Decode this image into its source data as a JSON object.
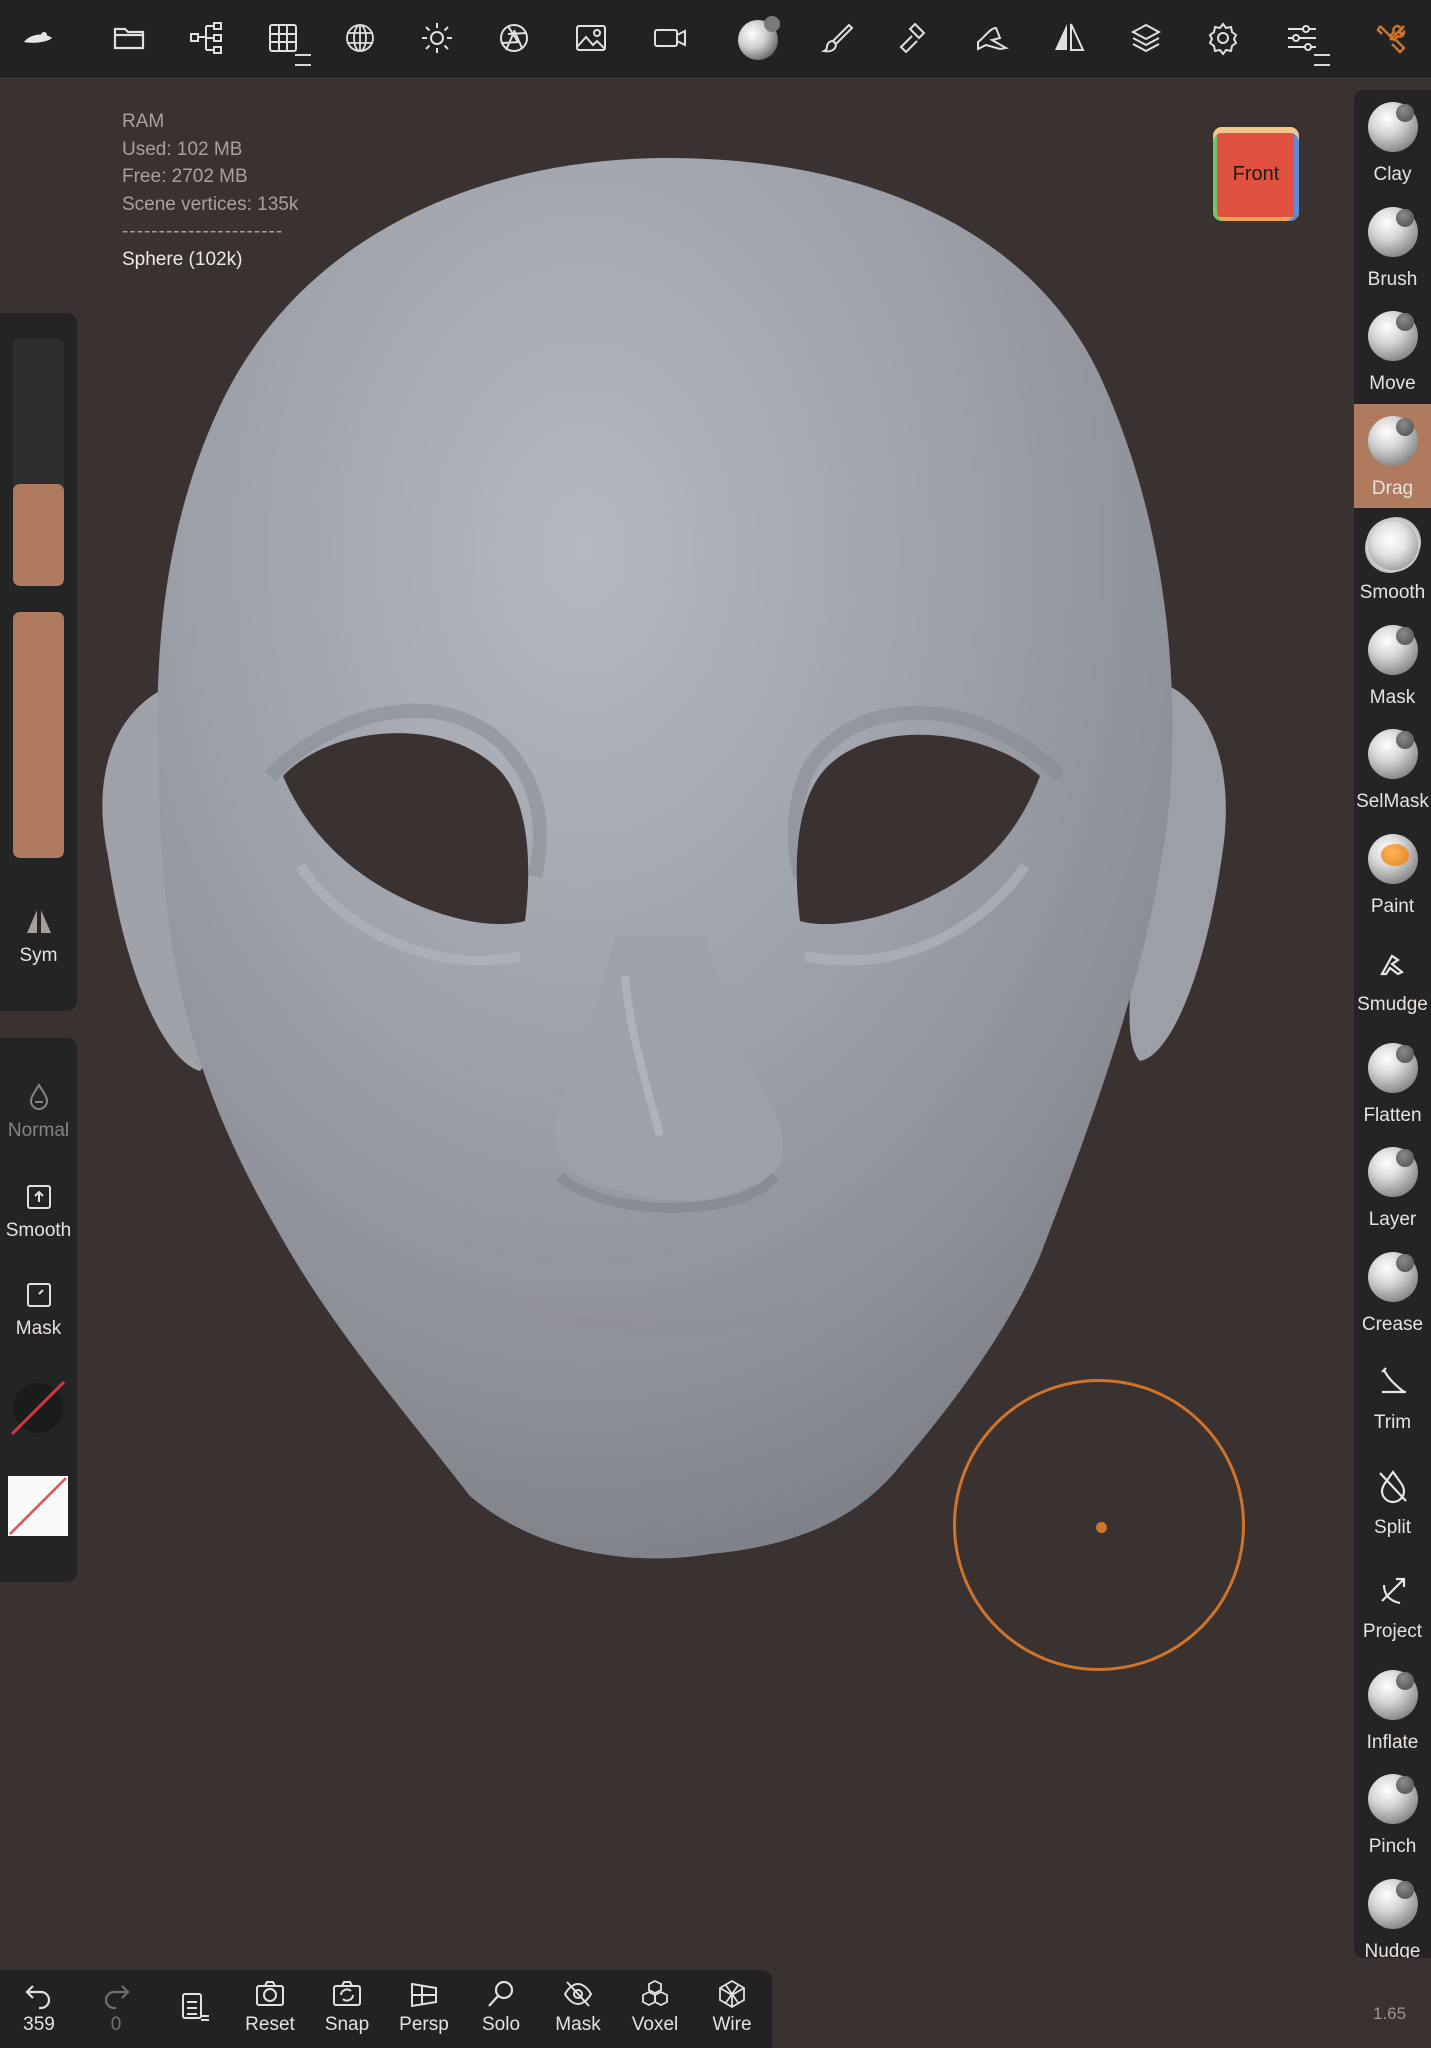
{
  "app": {
    "accent_color": "#b07a5e",
    "background_color": "#3a3230",
    "cursor_color": "#d0742c"
  },
  "topbar": {
    "icons": [
      "logo-icon",
      "folder-icon",
      "scene-tree-icon",
      "grid-icon",
      "mesh-sphere-icon",
      "light-icon",
      "aperture-icon",
      "image-icon",
      "camera-icon",
      "material-sphere-icon",
      "paint-brush-icon",
      "sculpt-hammer-icon",
      "topology-icon",
      "symmetry-icon",
      "layers-icon",
      "settings-icon",
      "sliders-icon",
      "tools-icon"
    ]
  },
  "stats": {
    "ram_label": "RAM",
    "used": "Used: 102 MB",
    "free": "Free: 2702 MB",
    "vertices": "Scene vertices: 135k",
    "separator": "----------------------",
    "object": "Sphere (102k)"
  },
  "viewcube": {
    "face": "Front"
  },
  "left_panel": {
    "radius_slider_level": 0.41,
    "intensity_slider_level": 1.0,
    "sym_label": "Sym",
    "normal_label": "Normal",
    "smooth_label": "Smooth",
    "mask_label": "Mask"
  },
  "tools": [
    {
      "label": "Clay",
      "icon": "clay-icon",
      "active": false
    },
    {
      "label": "Brush",
      "icon": "brush-icon",
      "active": false
    },
    {
      "label": "Move",
      "icon": "move-icon",
      "active": false
    },
    {
      "label": "Drag",
      "icon": "drag-icon",
      "active": true
    },
    {
      "label": "Smooth",
      "icon": "smooth-icon",
      "active": false
    },
    {
      "label": "Mask",
      "icon": "mask-icon",
      "active": false
    },
    {
      "label": "SelMask",
      "icon": "selmask-icon",
      "active": false
    },
    {
      "label": "Paint",
      "icon": "paint-icon",
      "active": false
    },
    {
      "label": "Smudge",
      "icon": "smudge-icon",
      "active": false
    },
    {
      "label": "Flatten",
      "icon": "flatten-icon",
      "active": false
    },
    {
      "label": "Layer",
      "icon": "layer-icon",
      "active": false
    },
    {
      "label": "Crease",
      "icon": "crease-icon",
      "active": false
    },
    {
      "label": "Trim",
      "icon": "trim-icon",
      "active": false
    },
    {
      "label": "Split",
      "icon": "split-icon",
      "active": false
    },
    {
      "label": "Project",
      "icon": "project-icon",
      "active": false
    },
    {
      "label": "Inflate",
      "icon": "inflate-icon",
      "active": false
    },
    {
      "label": "Pinch",
      "icon": "pinch-icon",
      "active": false
    },
    {
      "label": "Nudge",
      "icon": "nudge-icon",
      "active": false
    }
  ],
  "bottombar": {
    "undo_count": "359",
    "redo_count": "0",
    "reset": "Reset",
    "snap": "Snap",
    "persp": "Persp",
    "solo": "Solo",
    "mask": "Mask",
    "voxel": "Voxel",
    "wire": "Wire"
  },
  "zoom": "1.65"
}
